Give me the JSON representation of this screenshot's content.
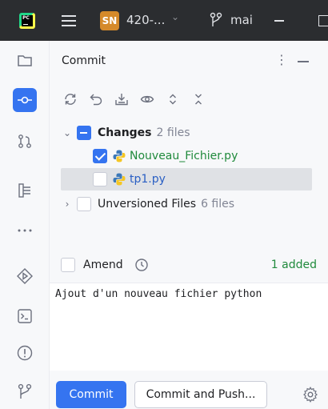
{
  "titlebar": {
    "app_logo_text": "PC",
    "project_badge": "SN",
    "project_name": "420-...",
    "branch_name": "mai",
    "icons": [
      "pycharm-logo-icon",
      "hamburger-menu-icon",
      "chevron-down-icon",
      "git-branch-icon",
      "minimize-icon",
      "maximize-icon"
    ]
  },
  "toolstrip": {
    "items": [
      {
        "name": "project",
        "icon": "folder-icon",
        "active": false
      },
      {
        "name": "commit",
        "icon": "commit-icon",
        "active": true
      },
      {
        "name": "pull-requests",
        "icon": "pull-request-icon",
        "active": false
      },
      {
        "name": "structure",
        "icon": "structure-icon",
        "active": false
      },
      {
        "name": "more",
        "icon": "more-icon",
        "active": false
      },
      {
        "name": "services",
        "icon": "run-services-icon",
        "active": false
      },
      {
        "name": "terminal",
        "icon": "terminal-icon",
        "active": false
      },
      {
        "name": "problems",
        "icon": "problems-icon",
        "active": false
      },
      {
        "name": "git",
        "icon": "git-icon",
        "active": false
      }
    ]
  },
  "panel": {
    "title": "Commit",
    "toolbar_icons": [
      "refresh-icon",
      "rollback-icon",
      "shelve-icon",
      "show-diff-icon",
      "expand-all-icon",
      "collapse-all-icon"
    ]
  },
  "changes": {
    "group_label": "Changes",
    "group_count": "2 files",
    "files": [
      {
        "name": "Nouveau_Fichier.py",
        "checked": true,
        "status": "added"
      },
      {
        "name": "tp1.py",
        "checked": false,
        "status": "modified"
      }
    ],
    "unversioned_label": "Unversioned Files",
    "unversioned_count": "6 files"
  },
  "commit_options": {
    "amend_label": "Amend",
    "amend_checked": false,
    "summary": "1 added"
  },
  "commit_message": "Ajout d'un nouveau fichier python",
  "buttons": {
    "commit": "Commit",
    "commit_and_push": "Commit and Push..."
  },
  "colors": {
    "accent": "#3574f0",
    "added": "#208a3c",
    "modified": "#2a5fc4",
    "titlebar": "#2b2d30",
    "project_badge": "#d58a2a"
  }
}
